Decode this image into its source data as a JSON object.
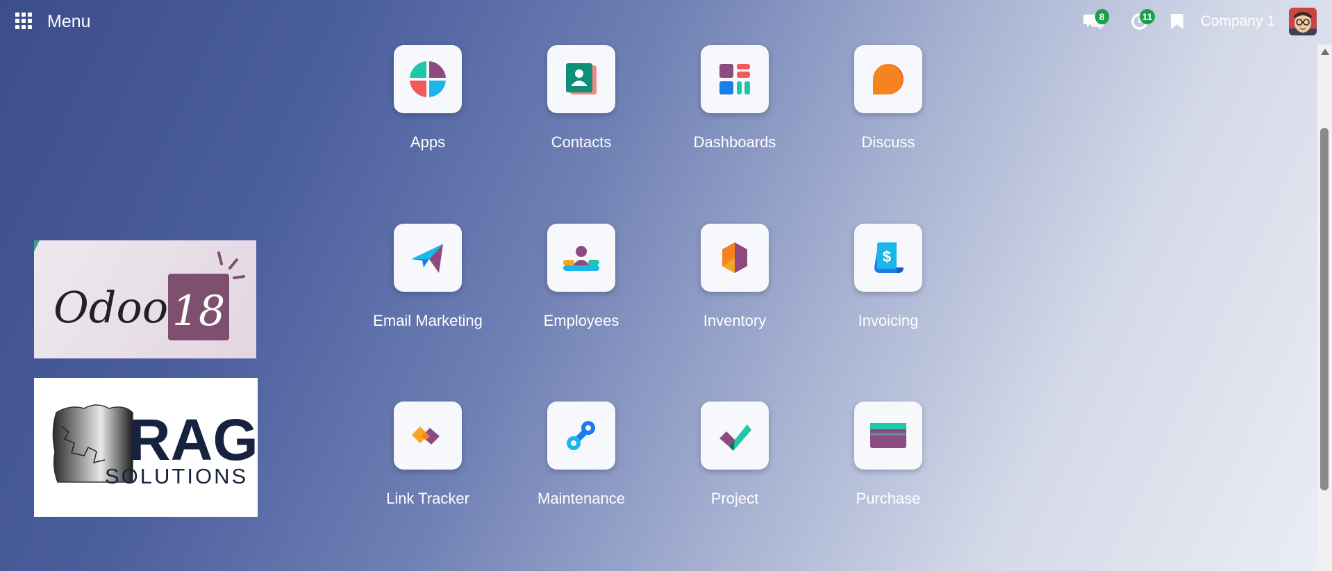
{
  "topbar": {
    "menu_label": "Menu",
    "menu_icon": "grid-icon",
    "chat_badge": "8",
    "activity_badge": "11",
    "company": "Company 1"
  },
  "apps": [
    {
      "label": "Apps",
      "icon": "apps-icon"
    },
    {
      "label": "Contacts",
      "icon": "contacts-icon"
    },
    {
      "label": "Dashboards",
      "icon": "dashboards-icon"
    },
    {
      "label": "Discuss",
      "icon": "discuss-icon"
    },
    {
      "label": "Email Marketing",
      "icon": "email-marketing-icon"
    },
    {
      "label": "Employees",
      "icon": "employees-icon"
    },
    {
      "label": "Inventory",
      "icon": "inventory-icon"
    },
    {
      "label": "Invoicing",
      "icon": "invoicing-icon"
    },
    {
      "label": "Link Tracker",
      "icon": "link-tracker-icon"
    },
    {
      "label": "Maintenance",
      "icon": "maintenance-icon"
    },
    {
      "label": "Project",
      "icon": "project-icon"
    },
    {
      "label": "Purchase",
      "icon": "purchase-icon"
    }
  ],
  "logos": {
    "odoo": {
      "text": "Odoo",
      "version": "18"
    },
    "rag": {
      "title": "RAG",
      "subtitle": "SOLUTIONS"
    }
  },
  "colors": {
    "badge": "#1aa04c",
    "odoo_purple": "#7e4f6e",
    "rag_navy": "#17223f"
  }
}
